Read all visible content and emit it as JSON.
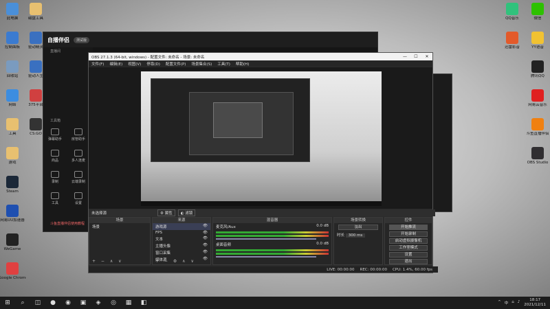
{
  "desktop_left": [
    {
      "label": "此电脑",
      "color": "#4a8fd8"
    },
    {
      "label": "控制面板",
      "color": "#3b7bd0"
    },
    {
      "label": "回收站",
      "color": "#7a9bbf"
    },
    {
      "label": "网络",
      "color": "#3c8de0"
    },
    {
      "label": "工具",
      "color": "#e8c070"
    },
    {
      "label": "游戏",
      "color": "#e8c070"
    },
    {
      "label": "Steam",
      "color": "#1b2838"
    },
    {
      "label": "网易UU加速器",
      "color": "#1e4fb0"
    },
    {
      "label": "WeGame",
      "color": "#222"
    },
    {
      "label": "Google Chrome",
      "color": "#e04040"
    }
  ],
  "desktop_col2": [
    {
      "label": "磁盘工具",
      "color": "#e8c070"
    },
    {
      "label": "驱动精灵",
      "color": "#3a70c0"
    },
    {
      "label": "驱动人生",
      "color": "#3a70c0"
    },
    {
      "label": "375平台",
      "color": "#d04040"
    },
    {
      "label": "CS:GO",
      "color": "#333"
    }
  ],
  "desktop_right": [
    {
      "label": "QQ音乐",
      "color": "#31c27c"
    },
    {
      "label": "微信",
      "color": "#2dc100"
    },
    {
      "label": "迅雷影音",
      "color": "#e35a2a"
    },
    {
      "label": "YY语音",
      "color": "#f1c232"
    },
    {
      "label": "腾讯QQ",
      "color": "#222"
    },
    {
      "label": "网易云音乐",
      "color": "#e02020"
    },
    {
      "label": "斗鱼直播伴侣",
      "color": "#f08010"
    },
    {
      "label": "OBS Studio",
      "color": "#302e31"
    }
  ],
  "zbhl": {
    "logo": "自播伴侣",
    "version": "测试版",
    "tab": "直播间",
    "tools_label": "工具箱",
    "tools": [
      "弹幕助手",
      "房管助手",
      "商品",
      "多人连麦",
      "录制",
      "云端录制",
      "工具",
      "设置"
    ],
    "footer": "斗鱼直播伴侣使用教程"
  },
  "obs": {
    "title": "OBS 27.1.3 (64-bit, windows) - 配置文件: 未命名 - 场景: 未命名",
    "menu": [
      "文件(F)",
      "编辑(E)",
      "视图(V)",
      "停靠(D)",
      "配置文件(P)",
      "场景集合(S)",
      "工具(T)",
      "帮助(H)"
    ],
    "source_label": "未选择源",
    "props_btn": "属性",
    "filter_btn": "滤镜",
    "scenes_header": "场景",
    "scene_item": "场景",
    "sources_header": "来源",
    "sources": [
      "游戏源",
      "FPS",
      "文本",
      "主播头像",
      "窗口采集",
      "媒体源"
    ],
    "mixer_header": "混音器",
    "mixer": [
      {
        "name": "麦克风/Aux",
        "db": "0.0 dB"
      },
      {
        "name": "桌面音频",
        "db": "0.0 dB"
      }
    ],
    "transition_header": "场景转换",
    "transition_value": "淡出",
    "duration_label": "时长",
    "duration_value": "300 ms",
    "controls_header": "控件",
    "controls": [
      "开始推流",
      "开始录制",
      "启动虚拟摄像机",
      "工作室模式",
      "设置",
      "退出"
    ],
    "status": [
      "LIVE: 00:00:00",
      "REC: 00:00:00",
      "CPU: 1.4%, 60.00 fps"
    ]
  },
  "taskbar": {
    "start": "⊞",
    "search": "⌕",
    "apps": [
      "◫",
      "●",
      "◉",
      "▣",
      "◈",
      "◎",
      "▦",
      "◧"
    ],
    "tray_icons": [
      "^",
      "中",
      "⌂",
      "♪"
    ],
    "time": "18:17",
    "date": "2021/12/11"
  }
}
